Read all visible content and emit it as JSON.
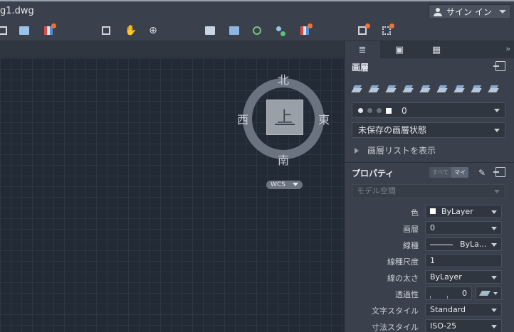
{
  "titlebar": {
    "title": "g1.dwg",
    "signin_label": "サイン イン"
  },
  "toolbar": {
    "icons": [
      "save-icon",
      "plot-icon",
      "layer-state-icon",
      "zoom-window-icon",
      "pan-hand-icon",
      "orbit-icon",
      "properties-icon",
      "match-properties-icon",
      "layer-icon",
      "layer-match-icon",
      "layer-isolate-icon",
      "render-icon",
      "view-icon"
    ]
  },
  "viewcube": {
    "face": "上",
    "north": "北",
    "south": "南",
    "east": "東",
    "west": "西",
    "wcs_label": "WCS"
  },
  "palette": {
    "tabs": [
      "layers-tab",
      "blocks-tab",
      "properties-tab"
    ],
    "more": "»",
    "layers": {
      "title": "画層",
      "current_layer": "0",
      "layer_state": "未保存の画層状態",
      "show_list": "画層リストを表示"
    },
    "properties": {
      "title": "プロパティ",
      "toggle_all": "すべて",
      "toggle_mine": "マイ",
      "model_space": "モデル空間",
      "rows": [
        {
          "label": "色",
          "value": "ByLayer"
        },
        {
          "label": "画層",
          "value": "0"
        },
        {
          "label": "線種",
          "value": "ByLa..."
        },
        {
          "label": "線種尺度",
          "value": "1"
        },
        {
          "label": "線の太さ",
          "value": "ByLayer"
        },
        {
          "label": "透過性",
          "value": "0"
        },
        {
          "label": "文字スタイル",
          "value": "Standard"
        },
        {
          "label": "寸法スタイル",
          "value": "ISO-25"
        }
      ]
    }
  },
  "colors": {
    "accent_badge": "#f2703a",
    "canvas_bg": "#222a35",
    "panel_bg": "#3a414c"
  }
}
